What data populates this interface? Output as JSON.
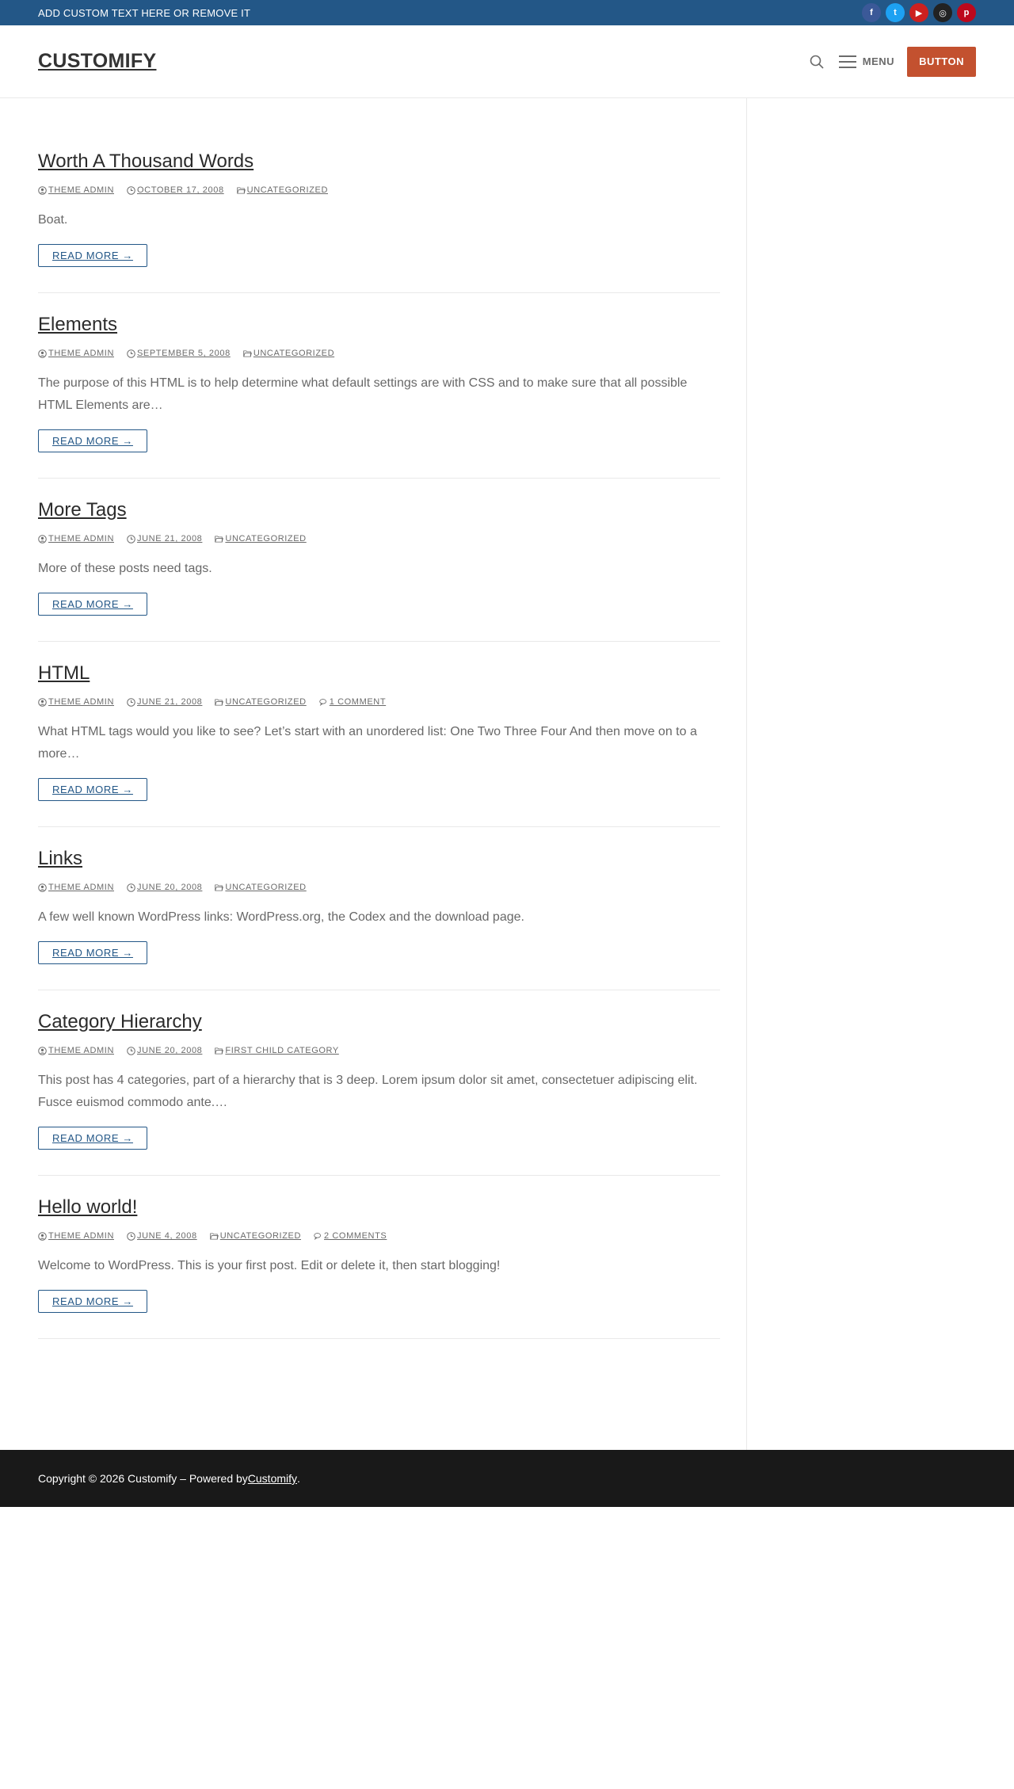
{
  "topbar": {
    "text": "ADD CUSTOM TEXT HERE OR REMOVE IT",
    "socials": [
      {
        "name": "facebook",
        "glyph": "f",
        "color": "#3b5998"
      },
      {
        "name": "twitter",
        "glyph": "t",
        "color": "#1da1f2"
      },
      {
        "name": "youtube",
        "glyph": "▶",
        "color": "#cd201f"
      },
      {
        "name": "instagram",
        "glyph": "◎",
        "color": "#222222"
      },
      {
        "name": "pinterest",
        "glyph": "p",
        "color": "#bd081c"
      }
    ]
  },
  "header": {
    "logo": "CUSTOMIFY",
    "menu_label": "MENU",
    "button_label": "BUTTON"
  },
  "posts": [
    {
      "title": "Worth A Thousand Words",
      "author": "THEME ADMIN",
      "date": "OCTOBER 17, 2008",
      "category": "UNCATEGORIZED",
      "comments": "",
      "excerpt": "Boat.",
      "readmore": "READ MORE →"
    },
    {
      "title": "Elements",
      "author": "THEME ADMIN",
      "date": "SEPTEMBER 5, 2008",
      "category": "UNCATEGORIZED",
      "comments": "",
      "excerpt": "The purpose of this HTML is to help determine what default settings are with CSS and to make sure that all possible HTML Elements are…",
      "readmore": "READ MORE →"
    },
    {
      "title": "More Tags",
      "author": "THEME ADMIN",
      "date": "JUNE 21, 2008",
      "category": "UNCATEGORIZED",
      "comments": "",
      "excerpt": "More of these posts need tags.",
      "readmore": "READ MORE →"
    },
    {
      "title": "HTML",
      "author": "THEME ADMIN",
      "date": "JUNE 21, 2008",
      "category": "UNCATEGORIZED",
      "comments": "1 COMMENT",
      "excerpt": "What HTML tags would you like to see? Let’s start with an unordered list: One Two Three Four And then move on to a more…",
      "readmore": "READ MORE →"
    },
    {
      "title": "Links",
      "author": "THEME ADMIN",
      "date": "JUNE 20, 2008",
      "category": "UNCATEGORIZED",
      "comments": "",
      "excerpt": "A few well known WordPress links: WordPress.org, the Codex and the download page.",
      "readmore": "READ MORE →"
    },
    {
      "title": "Category Hierarchy",
      "author": "THEME ADMIN",
      "date": "JUNE 20, 2008",
      "category": "FIRST CHILD CATEGORY",
      "comments": "",
      "excerpt": "This post has 4 categories, part of a hierarchy that is 3 deep. Lorem ipsum dolor sit amet, consectetuer adipiscing elit. Fusce euismod commodo ante.…",
      "readmore": "READ MORE →"
    },
    {
      "title": "Hello world!",
      "author": "THEME ADMIN",
      "date": "JUNE 4, 2008",
      "category": "UNCATEGORIZED",
      "comments": "2 COMMENTS",
      "excerpt": "Welcome to WordPress. This is your first post. Edit or delete it, then start blogging!",
      "readmore": "READ MORE →"
    }
  ],
  "footer": {
    "copyright": "Copyright © 2026 Customify – Powered by ",
    "link": "Customify",
    "suffix": "."
  }
}
